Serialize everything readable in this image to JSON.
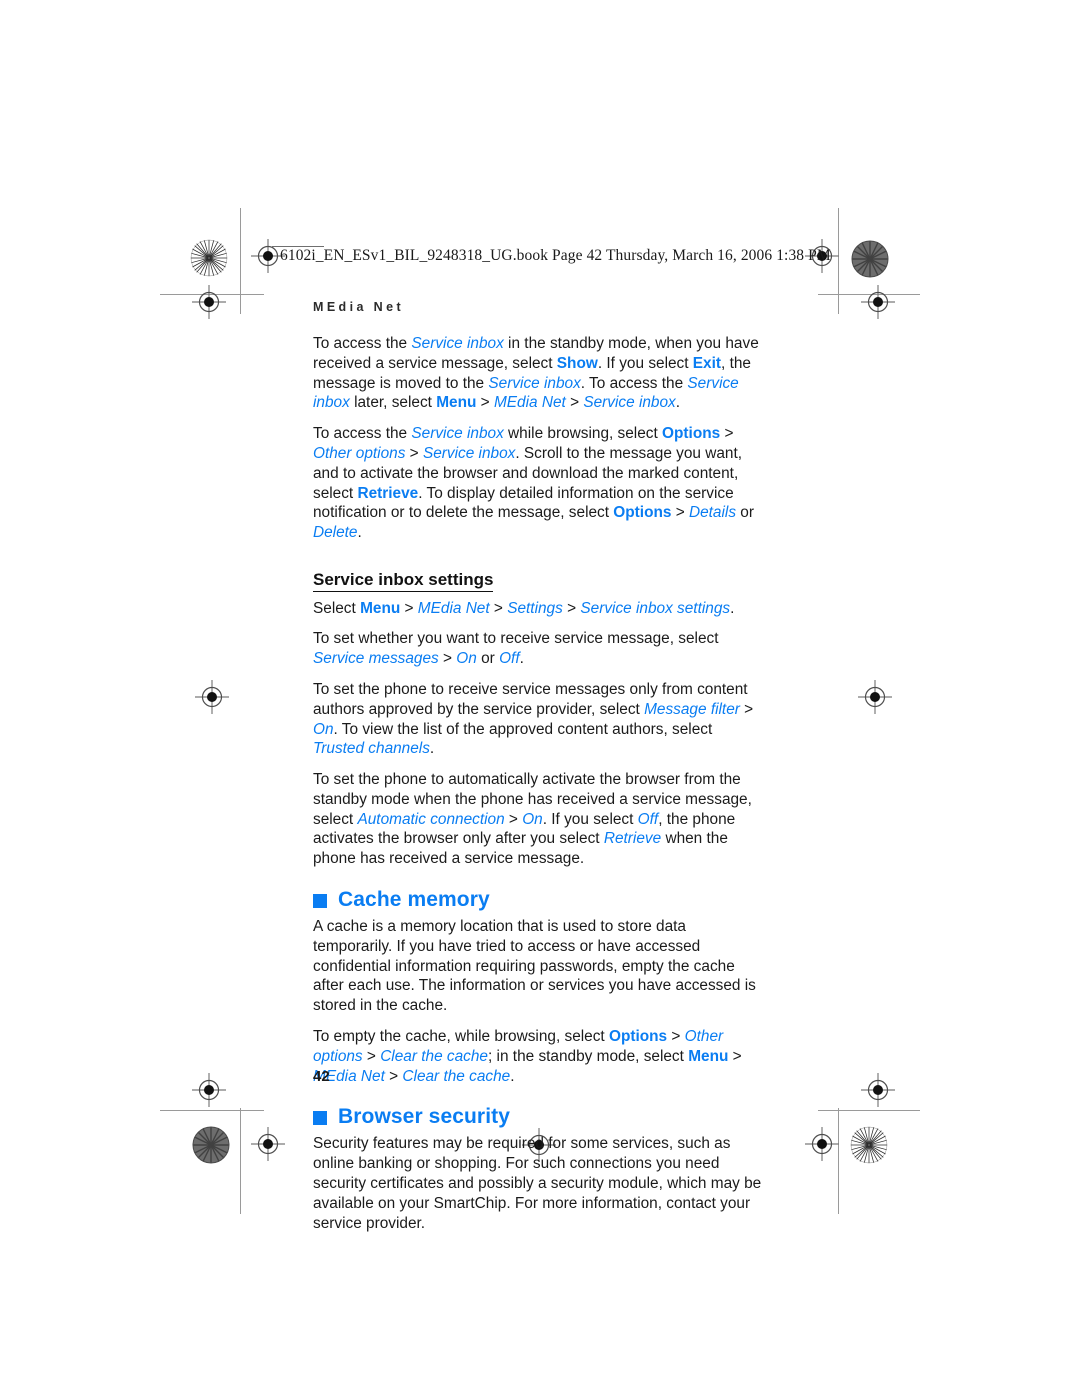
{
  "document": {
    "slug": "6102i_EN_ESv1_BIL_9248318_UG.book  Page 42  Thursday, March 16, 2006  1:38 PM",
    "running_head": "MEdia Net",
    "page_number": "42",
    "accent_color": "#0a7df2",
    "text_color": "#1b1b1b"
  },
  "paragraphs": {
    "p1": {
      "s1": "To access the ",
      "s2": "Service inbox",
      "s3": " in the standby mode, when you have received a service message, select ",
      "s4": "Show",
      "s5": ". If you select ",
      "s6": "Exit",
      "s7": ", the message is moved to the ",
      "s8": "Service inbox",
      "s9": ". To access the ",
      "s10": "Service inbox",
      "s11": " later, select ",
      "s12": "Menu",
      "s13": " > ",
      "s14": "MEdia Net",
      "s15": " > ",
      "s16": "Service inbox",
      "s17": "."
    },
    "p2": {
      "s1": "To access the ",
      "s2": "Service inbox",
      "s3": " while browsing, select ",
      "s4": "Options",
      "s5": " > ",
      "s6": "Other options",
      "s7": " > ",
      "s8": "Service inbox",
      "s9": ". Scroll to the message you want, and to activate the browser and download the marked content, select ",
      "s10": "Retrieve",
      "s11": ". To display detailed information on the service notification or to delete the message, select ",
      "s12": "Options",
      "s13": " > ",
      "s14": "Details",
      "s15": " or ",
      "s16": "Delete",
      "s17": "."
    },
    "p3": {
      "s1": "Select ",
      "s2": "Menu",
      "s3": " > ",
      "s4": "MEdia Net",
      "s5": " > ",
      "s6": "Settings",
      "s7": " > ",
      "s8": "Service inbox settings",
      "s9": "."
    },
    "p4": {
      "s1": "To set whether you want to receive service message, select ",
      "s2": "Service messages",
      "s3": " > ",
      "s4": "On",
      "s5": " or ",
      "s6": "Off",
      "s7": "."
    },
    "p5": {
      "s1": "To set the phone to receive service messages only from content authors approved by the service provider, select ",
      "s2": "Message filter",
      "s3": " > ",
      "s4": "On",
      "s5": ". To view the list of the approved content authors, select ",
      "s6": "Trusted channels",
      "s7": "."
    },
    "p6": {
      "s1": "To set the phone to automatically activate the browser from the standby mode when the phone has received a service message, select ",
      "s2": "Automatic connection",
      "s3": " > ",
      "s4": "On",
      "s5": ". If you select ",
      "s6": "Off",
      "s7": ", the phone activates the browser only after you select ",
      "s8": "Retrieve",
      "s9": " when the phone has received a service message."
    },
    "p7": {
      "s1": "A cache is a memory location that is used to store data temporarily. If you have tried to access or have accessed confidential information requiring passwords, empty the cache after each use. The information or services you have accessed is stored in the cache."
    },
    "p8": {
      "s1": "To empty the cache, while browsing, select ",
      "s2": "Options",
      "s3": " > ",
      "s4": "Other options",
      "s5": " > ",
      "s6": "Clear the cache",
      "s7": "; in the standby mode, select ",
      "s8": "Menu",
      "s9": " > ",
      "s10": "MEdia Net",
      "s11": " > ",
      "s12": "Clear the cache",
      "s13": "."
    },
    "p9": {
      "s1": "Security features may be required for some services, such as online banking or shopping. For such connections you need security certificates and possibly a security module, which may be available on your SmartChip. For more information, contact your service provider."
    }
  },
  "headings": {
    "service_inbox_settings": "Service inbox settings",
    "cache_memory": "Cache memory",
    "browser_security": "Browser security"
  }
}
